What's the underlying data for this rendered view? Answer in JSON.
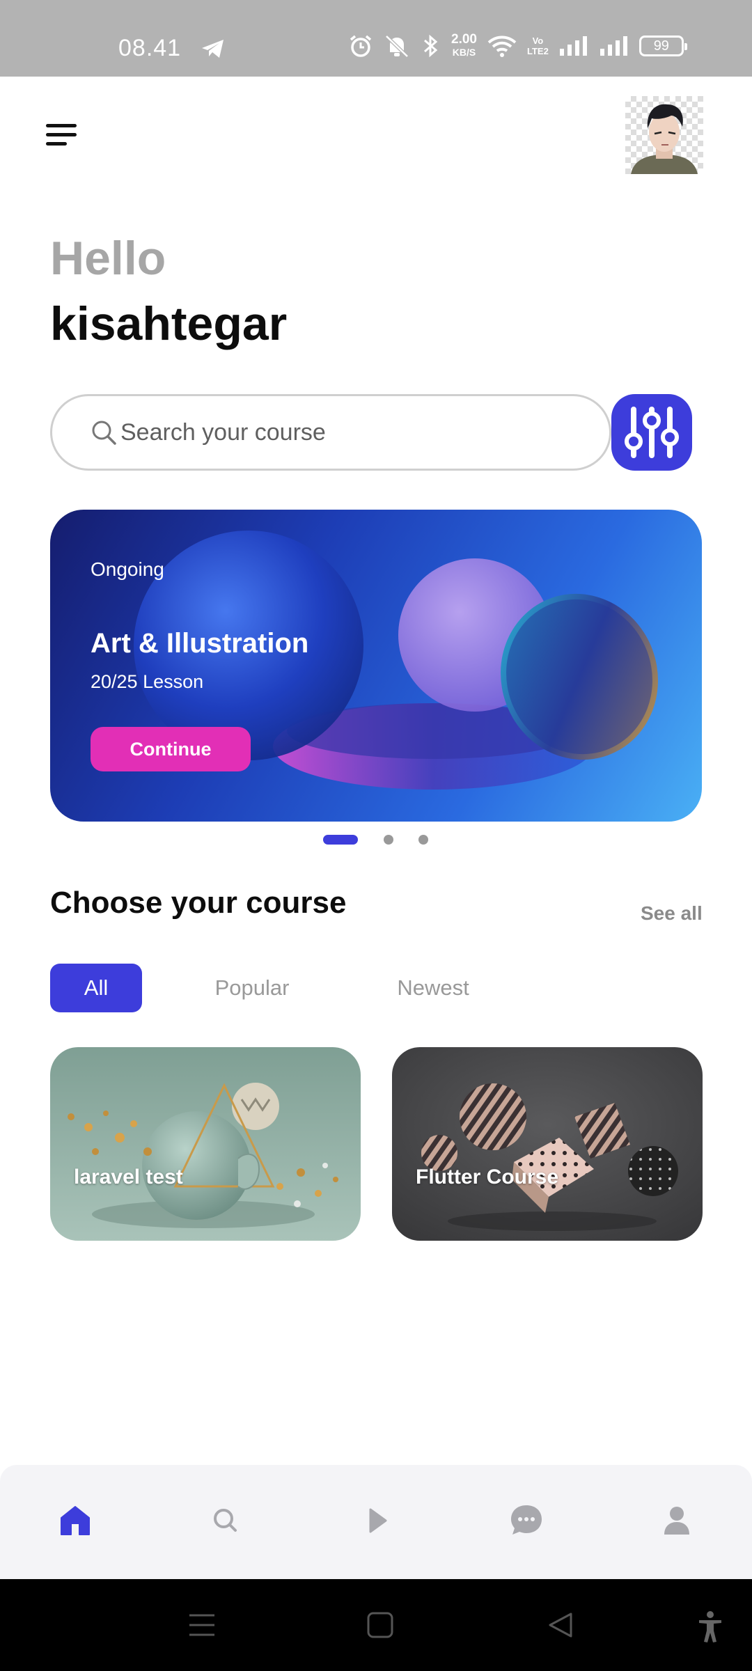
{
  "status_bar": {
    "time": "08.41",
    "net_speed": "2.00",
    "net_unit": "KB/S",
    "volte_line1": "Vo",
    "volte_line2": "LTE2",
    "battery": "99"
  },
  "header": {
    "menu_icon": "hamburger-menu-icon",
    "avatar_icon": "user-avatar"
  },
  "greeting": {
    "hello": "Hello",
    "username": "kisahtegar"
  },
  "search": {
    "placeholder": "Search your course",
    "icon": "search-icon",
    "filter_icon": "sliders-icon"
  },
  "banner": {
    "status": "Ongoing",
    "title": "Art & Illustration",
    "lessons": "20/25 Lesson",
    "button": "Continue",
    "active_slide": 1,
    "total_slides": 3
  },
  "courses_section": {
    "title": "Choose your course",
    "see_all": "See all",
    "tabs": [
      {
        "label": "All",
        "active": true
      },
      {
        "label": "Popular",
        "active": false
      },
      {
        "label": "Newest",
        "active": false
      }
    ],
    "cards": [
      {
        "title": "laravel test"
      },
      {
        "title": "Flutter Course"
      }
    ]
  },
  "bottom_nav": {
    "items": [
      "home-icon",
      "search-icon",
      "play-icon",
      "chat-icon",
      "profile-icon"
    ],
    "active": "home-icon"
  },
  "colors": {
    "accent": "#3d3ddb",
    "continue": "#e22fb6",
    "muted": "#a6a6a6"
  }
}
